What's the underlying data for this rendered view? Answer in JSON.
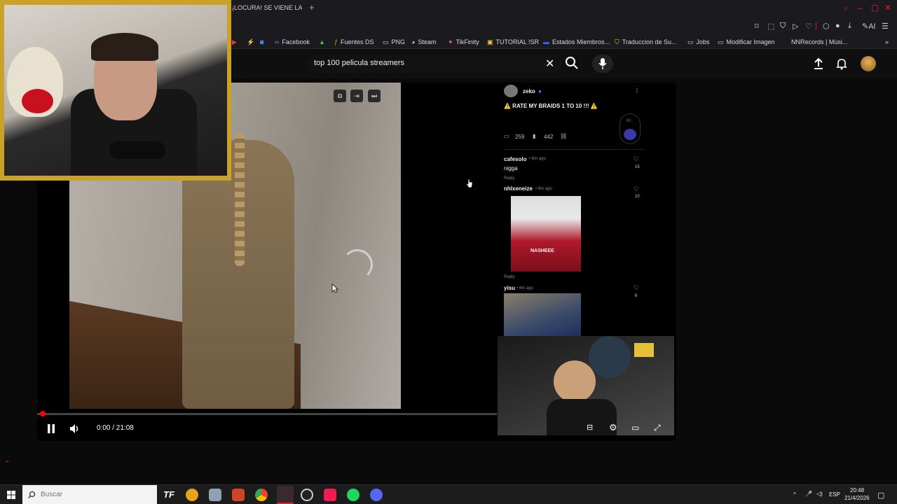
{
  "browser": {
    "tab_title": "¡LOCURA! SE VIENE LA PE",
    "new_tab": "+",
    "bookmarks": [
      "Facebook",
      "Fuentes DS",
      "PNG",
      "Steam",
      "TikFinity",
      "TUTORIAL !SR",
      "Estados Miembros...",
      "Traduccion de Su...",
      "Jobs",
      "Modificar Imagen",
      "NNRecords | Músi..."
    ],
    "ai_label": "AI"
  },
  "youtube": {
    "search_value": "top 100 pelicula streamers",
    "clear_symbol": "✕"
  },
  "comments_panel": {
    "author": "zeko",
    "post_text": "⚠️ RATE MY BRAIDS 1 TO 10 !!! ⚠️",
    "comment_count": "259",
    "views_count": "442",
    "counter_badge": "60",
    "comments": [
      {
        "user": "cafesolo",
        "time": "• 6m ago",
        "text": "nigga",
        "reply": "Reply",
        "likes": "15"
      },
      {
        "user": "nhlxeneize",
        "time": "• 6m ago",
        "text": "",
        "reply": "Reply",
        "likes": "10"
      },
      {
        "user": "yisu",
        "time": "• 6m ago",
        "text": "",
        "reply": "",
        "likes": "6"
      }
    ],
    "gif_caption": "NASHEEE"
  },
  "player": {
    "time_display": "0:00 / 21:08",
    "progress_fraction": 0.0
  },
  "taskbar": {
    "search_placeholder": "Buscar",
    "language": "ESP",
    "time": "20:48",
    "date": "21/4/2026"
  },
  "colors": {
    "accent_red": "#ff0000",
    "webcam_frame": "#c9a227"
  }
}
